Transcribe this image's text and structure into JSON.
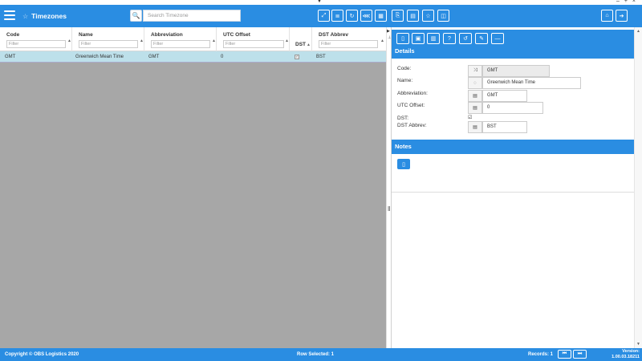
{
  "header": {
    "title": "Timezones",
    "search_placeholder": "Search Timezone"
  },
  "grid": {
    "columns": [
      {
        "label": "Code",
        "filter_placeholder": "Filter"
      },
      {
        "label": "Name",
        "filter_placeholder": "Filter"
      },
      {
        "label": "Abbreviation",
        "filter_placeholder": "Filter"
      },
      {
        "label": "UTC Offset",
        "filter_placeholder": "Filter"
      },
      {
        "label": "DST"
      },
      {
        "label": "DST Abbrev",
        "filter_placeholder": "Filter"
      }
    ],
    "rows": [
      {
        "code": "GMT",
        "name": "Greenwich Mean Time",
        "abbreviation": "GMT",
        "utc_offset": "0",
        "dst": true,
        "dst_abbrev": "BST"
      }
    ]
  },
  "details": {
    "section_title": "Details",
    "fields": {
      "code": {
        "label": "Code:",
        "value": "GMT"
      },
      "name": {
        "label": "Name:",
        "value": "Greenwich Mean Time"
      },
      "abbreviation": {
        "label": "Abbreviation:",
        "value": "GMT"
      },
      "utc_offset": {
        "label": "UTC Offset:",
        "value": "0"
      },
      "dst": {
        "label": "DST:",
        "checked": true
      },
      "dst_abbrev": {
        "label": "DST Abbrev:",
        "value": "BST"
      }
    }
  },
  "notes": {
    "section_title": "Notes"
  },
  "footer": {
    "copyright": "Copyright © OBS Logistics 2020",
    "row_selected": "Row Selected: 1",
    "records": "Records: 1",
    "version_label": "Version:",
    "version_number": "1.00.03.18211"
  },
  "colors": {
    "accent": "#2a8de2",
    "selected_row": "#bde0ea",
    "grid_background": "#a7a7a7"
  }
}
